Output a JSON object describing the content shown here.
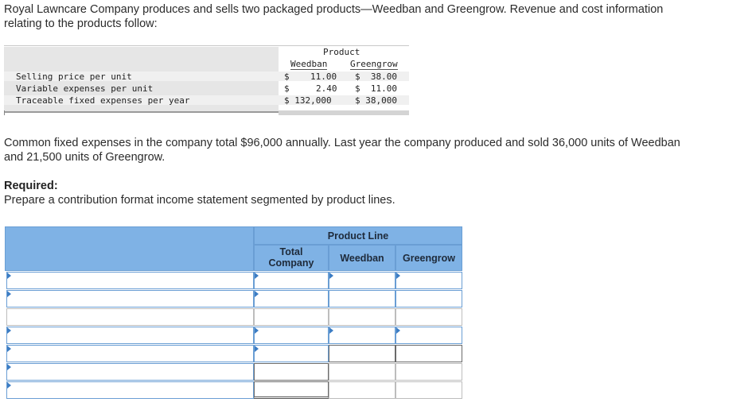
{
  "intro": {
    "line1": "Royal Lawncare Company produces and sells two packaged products—Weedban and Greengrow. Revenue and cost information",
    "line2": "relating to the products follow:"
  },
  "product_table": {
    "group_header": "Product",
    "columns": [
      "Weedban",
      "Greengrow"
    ],
    "rows": [
      {
        "label": "Selling price per unit",
        "weedban_sym": "$",
        "weedban": "11.00",
        "greengrow": "$  38.00"
      },
      {
        "label": "Variable expenses per unit",
        "weedban_sym": "$",
        "weedban": "2.40",
        "greengrow": "$  11.00"
      },
      {
        "label": "Traceable fixed expenses per year",
        "weedban_sym": "$ 132,000",
        "weedban": "",
        "greengrow": "$ 38,000"
      }
    ]
  },
  "common": {
    "line1": "Common fixed expenses in the company total $96,000 annually. Last year the company produced and sold 36,000 units of Weedban",
    "line2": "and 21,500 units of Greengrow."
  },
  "required": {
    "label": "Required:",
    "text": "Prepare a contribution format income statement segmented by product lines."
  },
  "answer_table": {
    "product_line": "Product Line",
    "total_line1": "Total",
    "total_line2": "Company",
    "weedban": "Weedban",
    "greengrow": "Greengrow",
    "row_count": 7
  }
}
